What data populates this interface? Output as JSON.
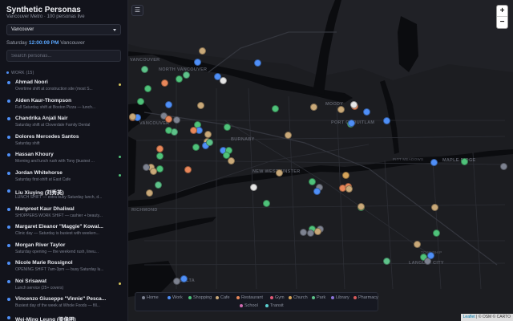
{
  "app": {
    "title": "Synthetic Personas",
    "subtitle": "Vancouver Metro · 100 personas live",
    "region": "Vancouver",
    "clock_day": "Saturday",
    "clock_time": "12:00:09 PM",
    "clock_city": "Vancouver",
    "search_placeholder": "Search personas..."
  },
  "group": {
    "label": "WORK (15)"
  },
  "personas": [
    {
      "name": "Ahmad Noori",
      "desc": "Overtime shift at construction site (most S...",
      "status_color": "#d6c45a"
    },
    {
      "name": "Aiden Kaur-Thompson",
      "desc": "Full Saturday shift at Boston Pizza — lunch...",
      "status_color": ""
    },
    {
      "name": "Chandrika Anjali Nair",
      "desc": "Saturday shift at Cloverdale Family Dental",
      "status_color": ""
    },
    {
      "name": "Dolores Mercedes Santos",
      "desc": "Saturday shift",
      "status_color": ""
    },
    {
      "name": "Hassan Khoury",
      "desc": "Morning and lunch rush with Tony (busiest ...",
      "status_color": "#4fc27a"
    },
    {
      "name": "Jordan Whitehorse",
      "desc": "Saturday first-shift at East Cafe",
      "status_color": "#4fc27a"
    },
    {
      "name": "Liu Xiuying (刘秀英)",
      "desc": "LUNCH SHIFT — extra busy Saturday lunch, d...",
      "status_color": ""
    },
    {
      "name": "Manpreet Kaur Dhaliwal",
      "desc": "SHOPPERS WORK SHIFT — cashier + beauty...",
      "status_color": ""
    },
    {
      "name": "Margaret Eleanor \"Maggie\" Kowal...",
      "desc": "Clinic day — Saturday is busiest with weeken...",
      "status_color": ""
    },
    {
      "name": "Morgan River Taylor",
      "desc": "Saturday opening — the weekend rush, lineu...",
      "status_color": ""
    },
    {
      "name": "Nicole Marie Rossignol",
      "desc": "OPENING SHIFT 7am-3pm — busy Saturday lu...",
      "status_color": ""
    },
    {
      "name": "Noi Srisawat",
      "desc": "Lunch service (25+ covers)",
      "status_color": "#d6c45a"
    },
    {
      "name": "Vincenzo Giuseppe \"Vinnie\" Pesca...",
      "desc": "Busiest day of the week at Whole Foods — fill...",
      "status_color": ""
    },
    {
      "name": "Wei-Ming Leung (梁偉明)",
      "desc": "",
      "status_color": ""
    }
  ],
  "map": {
    "labels": [
      {
        "text": "VANCOUVER",
        "size": "big"
      },
      {
        "text": "NORTH VANCOUVER",
        "size": "big"
      },
      {
        "text": "MOODY",
        "size": "big"
      },
      {
        "text": "PORT COQUITLAM",
        "size": "big"
      },
      {
        "text": "VANCOUVER",
        "size": "big"
      },
      {
        "text": "BURNABY",
        "size": "big"
      },
      {
        "text": "Pitt Meadows",
        "size": "small"
      },
      {
        "text": "MAPLE RIDGE",
        "size": "big"
      },
      {
        "text": "NEW WESTMINSTER",
        "size": "big"
      },
      {
        "text": "RICHMOND",
        "size": "big"
      },
      {
        "text": "Township",
        "size": "small"
      },
      {
        "text": "LANGLEY CITY",
        "size": "big"
      },
      {
        "text": "DELTA",
        "size": "big"
      }
    ],
    "zoom_in": "+",
    "zoom_out": "−",
    "menu_icon": "☰",
    "attribution_leaflet": "Leaflet",
    "attribution_rest": " | © OSM © CARTO"
  },
  "legend": [
    {
      "label": "Home",
      "color": "#7d8290"
    },
    {
      "label": "Work",
      "color": "#4f8ff7"
    },
    {
      "label": "Shopping",
      "color": "#4fc27a"
    },
    {
      "label": "Cafe",
      "color": "#c9a979"
    },
    {
      "label": "Restaurant",
      "color": "#e8875a"
    },
    {
      "label": "Gym",
      "color": "#e05a78"
    },
    {
      "label": "Church",
      "color": "#d6a45a"
    },
    {
      "label": "Park",
      "color": "#5ec28a"
    },
    {
      "label": "Library",
      "color": "#8a72d6"
    },
    {
      "label": "Pharmacy",
      "color": "#d65a5a"
    },
    {
      "label": "School",
      "color": "#d06ab0"
    },
    {
      "label": "Transit",
      "color": "#5ad0d0"
    }
  ],
  "markers": [
    {
      "color": "#c9a979"
    },
    {
      "color": "#4f8ff7"
    },
    {
      "color": "#4f8ff7"
    },
    {
      "color": "#5ec28a"
    },
    {
      "color": "#4fc27a"
    },
    {
      "color": "#4f8ff7"
    },
    {
      "color": "#e6e6e6"
    },
    {
      "color": "#4fc27a"
    },
    {
      "color": "#5ec28a"
    },
    {
      "color": "#e8875a"
    },
    {
      "color": "#4fc27a"
    },
    {
      "color": "#4f8ff7"
    },
    {
      "color": "#e8875a"
    },
    {
      "color": "#c9a979"
    },
    {
      "color": "#7d8290"
    },
    {
      "color": "#7d8290"
    },
    {
      "color": "#4fc27a"
    },
    {
      "color": "#4f8ff7"
    },
    {
      "color": "#e8875a"
    },
    {
      "color": "#4fc27a"
    },
    {
      "color": "#4f8ff7"
    },
    {
      "color": "#c9a979"
    },
    {
      "color": "#5ec28a"
    },
    {
      "color": "#4fc27a"
    },
    {
      "color": "#e8875a"
    },
    {
      "color": "#c9a979"
    },
    {
      "color": "#4fc27a"
    },
    {
      "color": "#4f8ff7"
    },
    {
      "color": "#4fc27a"
    },
    {
      "color": "#e8875a"
    },
    {
      "color": "#c9a979"
    },
    {
      "color": "#4fc27a"
    },
    {
      "color": "#4f8ff7"
    },
    {
      "color": "#5ec28a"
    },
    {
      "color": "#c9a979"
    },
    {
      "color": "#7d8290"
    },
    {
      "color": "#4fc27a"
    },
    {
      "color": "#e8875a"
    },
    {
      "color": "#e6e6e6"
    },
    {
      "color": "#c9a979"
    },
    {
      "color": "#4fc27a"
    },
    {
      "color": "#7d8290"
    },
    {
      "color": "#4f8ff7"
    },
    {
      "color": "#c9a979"
    },
    {
      "color": "#e8875a"
    },
    {
      "color": "#e8875a"
    },
    {
      "color": "#4f8ff7"
    },
    {
      "color": "#d6a45a"
    },
    {
      "color": "#c9a979"
    },
    {
      "color": "#5ec28a"
    },
    {
      "color": "#4f8ff7"
    },
    {
      "color": "#e8875a"
    },
    {
      "color": "#7d8290"
    },
    {
      "color": "#4fc27a"
    },
    {
      "color": "#e6e6e6"
    },
    {
      "color": "#4f8ff7"
    },
    {
      "color": "#c9a979"
    },
    {
      "color": "#4fc27a"
    },
    {
      "color": "#4fc27a"
    },
    {
      "color": "#7d8290"
    },
    {
      "color": "#4f8ff7"
    },
    {
      "color": "#c9a979"
    },
    {
      "color": "#7d8290"
    }
  ]
}
